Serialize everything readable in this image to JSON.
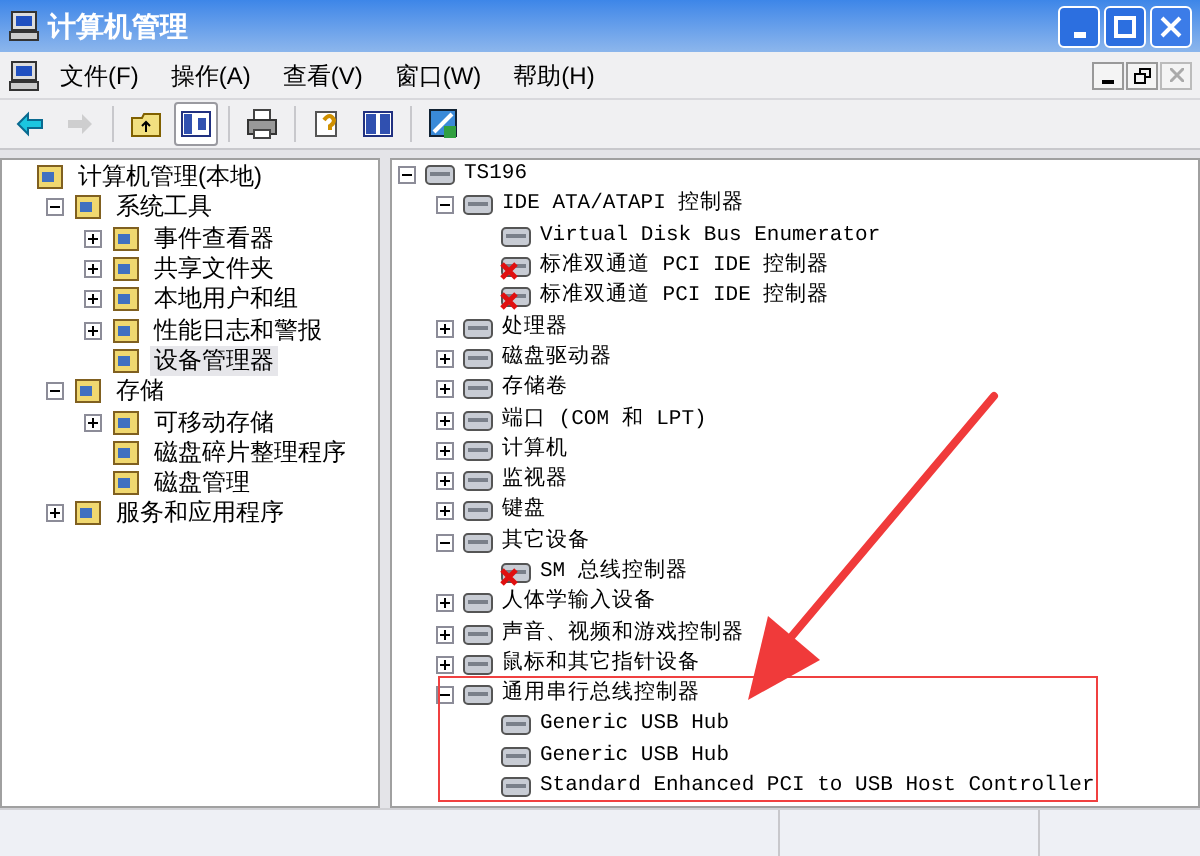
{
  "window": {
    "title": "计算机管理"
  },
  "menu": [
    "文件(F)",
    "操作(A)",
    "查看(V)",
    "窗口(W)",
    "帮助(H)"
  ],
  "toolbar": [
    {
      "kind": "back",
      "disabled": false,
      "pressed": false
    },
    {
      "kind": "forward",
      "disabled": true,
      "pressed": false
    },
    {
      "kind": "up",
      "disabled": false,
      "pressed": false
    },
    {
      "kind": "tree",
      "disabled": false,
      "pressed": true
    },
    {
      "kind": "print",
      "disabled": false,
      "pressed": false
    },
    {
      "kind": "help",
      "disabled": false,
      "pressed": false
    },
    {
      "kind": "panel",
      "disabled": false,
      "pressed": false
    },
    {
      "kind": "device",
      "disabled": false,
      "pressed": false
    }
  ],
  "left_tree": [
    {
      "label": "计算机管理(本地)",
      "selected": false,
      "children": [
        {
          "label": "系统工具",
          "selected": false,
          "expanded": true,
          "children": [
            {
              "label": "事件查看器",
              "selected": false,
              "expanded": false
            },
            {
              "label": "共享文件夹",
              "selected": false,
              "expanded": false
            },
            {
              "label": "本地用户和组",
              "selected": false,
              "expanded": false
            },
            {
              "label": "性能日志和警报",
              "selected": false,
              "expanded": false
            },
            {
              "label": "设备管理器",
              "selected": true
            }
          ]
        },
        {
          "label": "存储",
          "selected": false,
          "expanded": true,
          "children": [
            {
              "label": "可移动存储",
              "selected": false,
              "expanded": false
            },
            {
              "label": "磁盘碎片整理程序",
              "selected": false
            },
            {
              "label": "磁盘管理",
              "selected": false
            }
          ]
        },
        {
          "label": "服务和应用程序",
          "selected": false,
          "expanded": false
        }
      ]
    }
  ],
  "device_tree": [
    {
      "label": "TS196",
      "expanded": true,
      "error": false,
      "children": [
        {
          "label": "IDE ATA/ATAPI 控制器",
          "expanded": true,
          "error": false,
          "children": [
            {
              "label": "Virtual Disk Bus Enumerator",
              "error": false
            },
            {
              "label": "标准双通道 PCI IDE 控制器",
              "error": true
            },
            {
              "label": "标准双通道 PCI IDE 控制器",
              "error": true
            }
          ]
        },
        {
          "label": "处理器",
          "expanded": false,
          "error": false
        },
        {
          "label": "磁盘驱动器",
          "expanded": false,
          "error": false
        },
        {
          "label": "存储卷",
          "expanded": false,
          "error": false
        },
        {
          "label": "端口 (COM 和 LPT)",
          "expanded": false,
          "error": false
        },
        {
          "label": "计算机",
          "expanded": false,
          "error": false
        },
        {
          "label": "监视器",
          "expanded": false,
          "error": false
        },
        {
          "label": "键盘",
          "expanded": false,
          "error": false
        },
        {
          "label": "其它设备",
          "expanded": true,
          "error": false,
          "children": [
            {
              "label": "SM 总线控制器",
              "error": true
            }
          ]
        },
        {
          "label": "人体学输入设备",
          "expanded": false,
          "error": false
        },
        {
          "label": "声音、视频和游戏控制器",
          "expanded": false,
          "error": false
        },
        {
          "label": "鼠标和其它指针设备",
          "expanded": false,
          "error": false
        },
        {
          "label": "通用串行总线控制器",
          "expanded": true,
          "error": false,
          "children": [
            {
              "label": "Generic USB Hub",
              "error": false
            },
            {
              "label": "Generic USB Hub",
              "error": false
            },
            {
              "label": "Standard Enhanced PCI to USB Host Controller",
              "error": false
            }
          ]
        }
      ]
    }
  ]
}
